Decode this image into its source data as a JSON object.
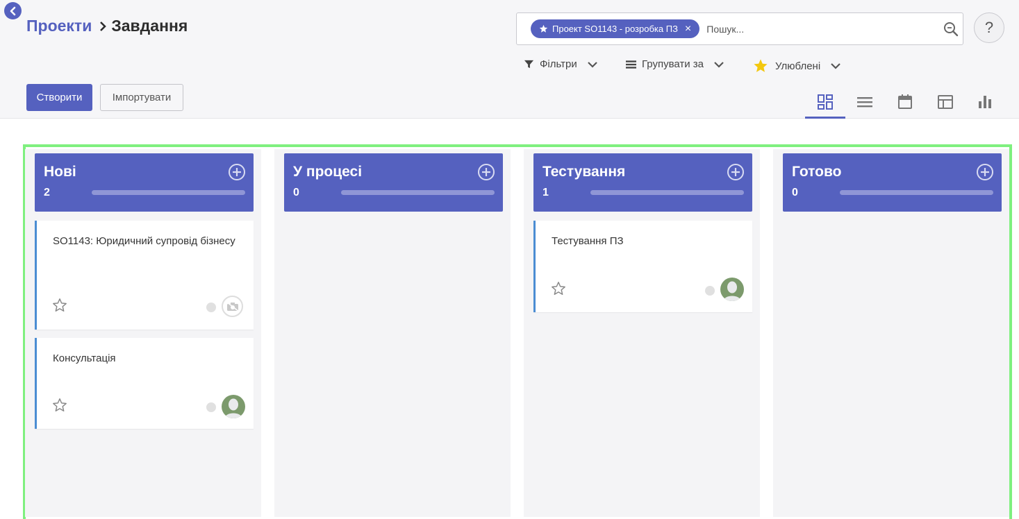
{
  "breadcrumb": {
    "parent": "Проекти",
    "current": "Завдання"
  },
  "search": {
    "facet_label": "Проект SO1143 - розробка ПЗ",
    "facet_close": "×",
    "placeholder": "Пошук..."
  },
  "help": {
    "label": "?"
  },
  "filters": [
    {
      "label": "Фільтри",
      "icon": "filter-icon"
    },
    {
      "label": "Групувати за",
      "icon": "group-icon"
    },
    {
      "label": "Улюблені",
      "icon": "star-icon"
    }
  ],
  "actions": {
    "create": "Створити",
    "import": "Імпортувати"
  },
  "views": [
    "kanban-view-icon",
    "list-view-icon",
    "calendar-view-icon",
    "pivot-view-icon",
    "graph-view-icon"
  ],
  "colors": {
    "accent": "#5561bf",
    "card_border": "#4b8dd3",
    "highlight": "#7ff07f",
    "star_gold": "#f3c80f"
  },
  "columns": [
    {
      "title": "Нові",
      "count": "2",
      "cards": [
        {
          "title": "SO1143: Юридичний супровід бізнесу",
          "assignee": "camera-placeholder"
        },
        {
          "title": "Консультація",
          "assignee": "avatar"
        }
      ]
    },
    {
      "title": "У процесі",
      "count": "0",
      "cards": []
    },
    {
      "title": "Тестування",
      "count": "1",
      "cards": [
        {
          "title": "Тестування ПЗ",
          "assignee": "avatar"
        }
      ]
    },
    {
      "title": "Готово",
      "count": "0",
      "cards": []
    }
  ]
}
